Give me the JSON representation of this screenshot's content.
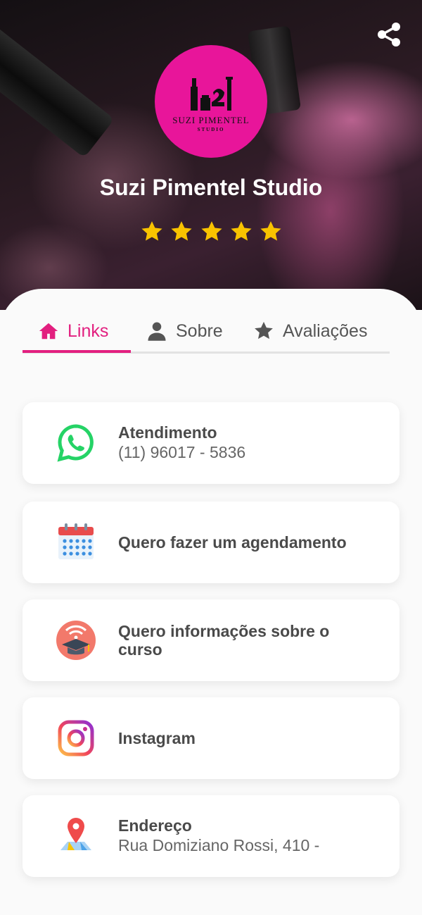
{
  "profile": {
    "logo_name": "SUZI PIMENTEL",
    "logo_sub": "STUDIO",
    "title": "Suzi Pimentel Studio",
    "rating_stars": 5
  },
  "tabs": [
    {
      "label": "Links",
      "icon": "home-icon",
      "active": true
    },
    {
      "label": "Sobre",
      "icon": "user-icon",
      "active": false
    },
    {
      "label": "Avaliações",
      "icon": "star-icon",
      "active": false
    }
  ],
  "links": [
    {
      "title": "Atendimento",
      "subtitle": "(11) 96017 - 5836",
      "icon": "whatsapp-icon"
    },
    {
      "title": "Quero fazer um agendamento",
      "subtitle": "",
      "icon": "calendar-icon"
    },
    {
      "title": "Quero informações sobre o curso",
      "subtitle": "",
      "icon": "graduation-cap-icon"
    },
    {
      "title": "Instagram",
      "subtitle": "",
      "icon": "instagram-icon"
    },
    {
      "title": "Endereço",
      "subtitle": "Rua Domiziano Rossi, 410 -",
      "icon": "map-pin-icon"
    }
  ],
  "colors": {
    "brand_pink": "#e8159a",
    "active_tab": "#e21f7f",
    "star": "#f8c300",
    "whatsapp": "#25d366"
  }
}
